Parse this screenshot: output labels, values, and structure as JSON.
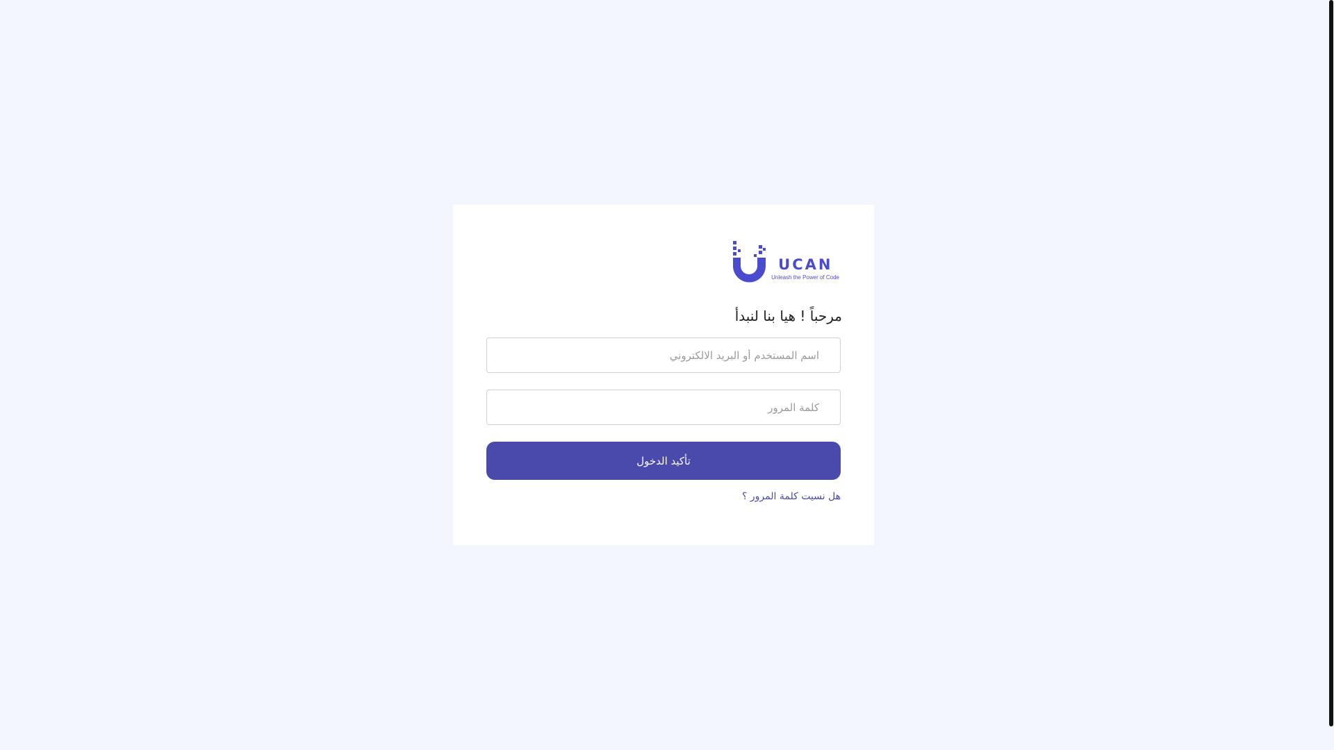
{
  "brand": {
    "name": "UCAN",
    "tagline": "Unleash the Power of Code",
    "color": "#4b4bd0"
  },
  "login": {
    "title": "مرحباً ! هيا بنا لنبدأ",
    "username_placeholder": "اسم المستخدم أو البريد الالكتروني",
    "password_placeholder": "كلمة المرور",
    "submit_label": "تأكيد الدخول",
    "forgot_link": "هل نسيت كلمة المرور ؟"
  },
  "colors": {
    "page_background": "#f3f6fe",
    "card_background": "#ffffff",
    "button": "#4a4aad",
    "link": "#4a4aad"
  },
  "icons": {
    "logo": "ucan-logo-icon"
  }
}
